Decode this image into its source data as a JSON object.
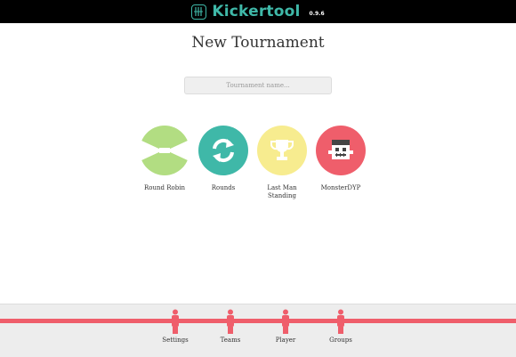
{
  "header": {
    "brand": "Kickertool",
    "version": "0.9.6",
    "logo_icon": "foosball-table-icon"
  },
  "page": {
    "title": "New Tournament",
    "name_placeholder": "Tournament name..."
  },
  "modes": [
    {
      "label": "Round Robin",
      "icon": "round-robin-icon",
      "color": "#b2dd82"
    },
    {
      "label": "Rounds",
      "icon": "refresh-icon",
      "color": "#3fb8a8"
    },
    {
      "label": "Last Man Standing",
      "icon": "trophy-icon",
      "color": "#f7ec8f"
    },
    {
      "label": "MonsterDYP",
      "icon": "monster-icon",
      "color": "#ef5e6b"
    }
  ],
  "footer": {
    "rod_color": "#ef5e6b",
    "nav": [
      {
        "label": "Settings"
      },
      {
        "label": "Teams"
      },
      {
        "label": "Player"
      },
      {
        "label": "Groups"
      }
    ]
  }
}
